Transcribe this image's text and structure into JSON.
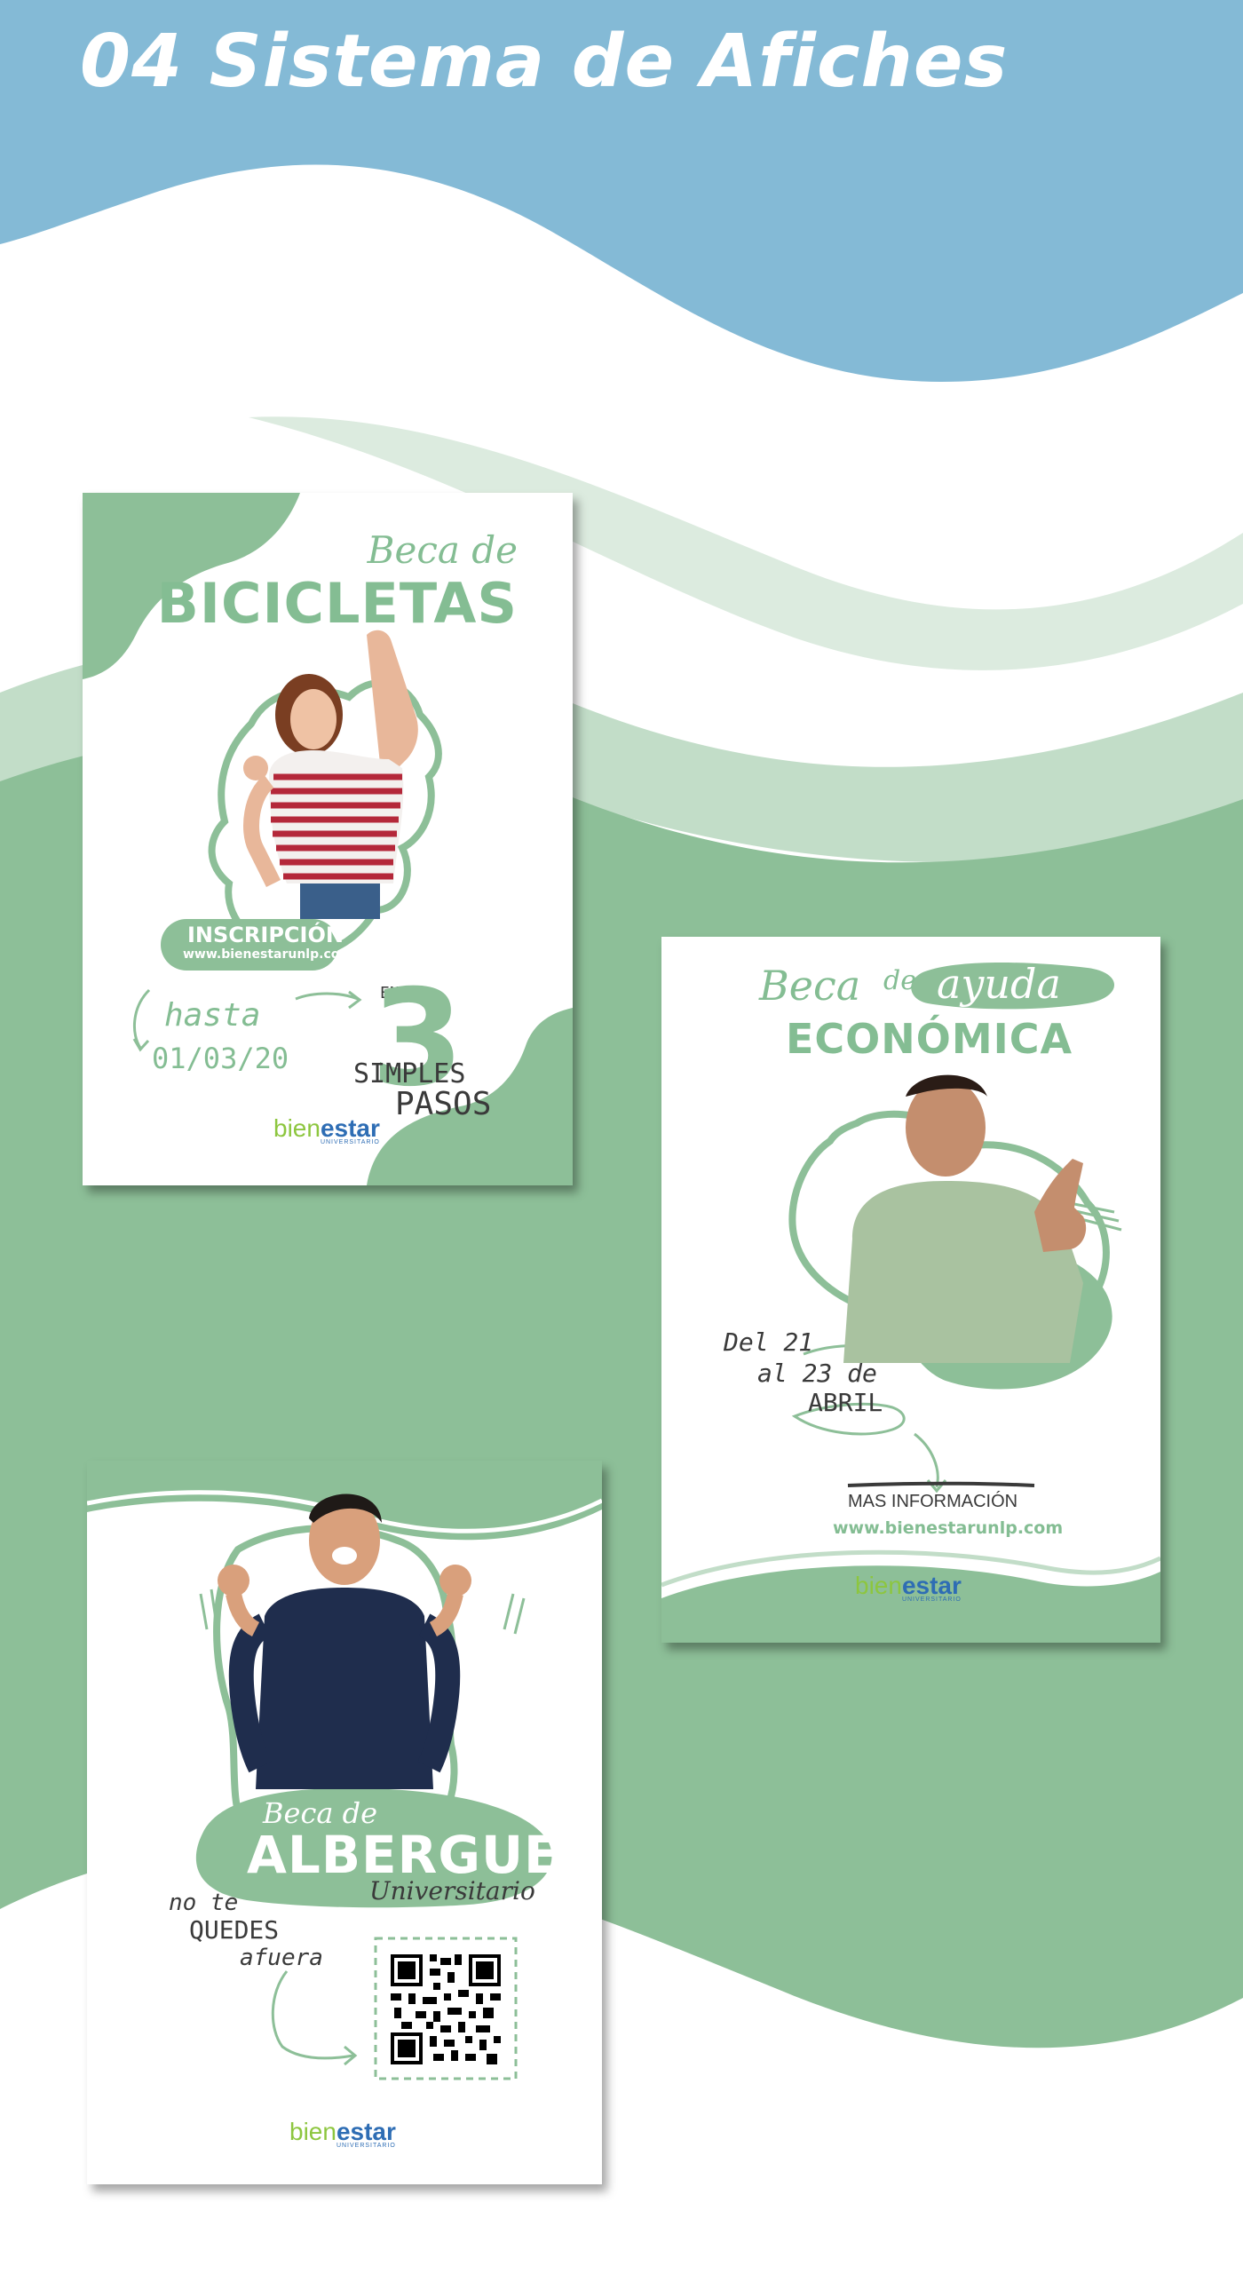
{
  "page": {
    "title": "04 Sistema de Afiches",
    "colors": {
      "header_blue": "#84bad6",
      "green": "#8dbf98",
      "light_green": "#c2ddc8",
      "text_green": "#84bd93",
      "dark_text": "#3a3a3a"
    }
  },
  "poster1": {
    "beca": "Beca de",
    "name": "BICICLETAS",
    "inscripcion": "INSCRIPCIÓN",
    "url": "www.bienestarunlp.com",
    "hasta": "hasta",
    "date": "01/03/20",
    "en": "EN",
    "number": "3",
    "simples": "SIMPLES",
    "pasos": "PASOS",
    "photo": "woman-cheering-striped-shirt"
  },
  "poster2": {
    "beca": "Beca",
    "de": "de",
    "ayuda": "ayuda",
    "name": "ECONÓMICA",
    "dates_line1": "Del 21",
    "dates_line2": "al 23 de",
    "dates_line3": "ABRIL",
    "mas_info": "MAS INFORMACIÓN",
    "url": "www.bienestarunlp.com",
    "photo": "man-thumbs-up-green-hoodie"
  },
  "poster3": {
    "beca": "Beca de",
    "name": "ALBERGUE",
    "sub": "Universitario",
    "line1": "no te",
    "line2": "QUEDES",
    "line3": "afuera",
    "photo": "man-cheering-navy-sweater",
    "qr": "qr-code"
  },
  "logo": {
    "part1": "bien",
    "part2": "estar",
    "sub": "UNIVERSITARIO"
  }
}
